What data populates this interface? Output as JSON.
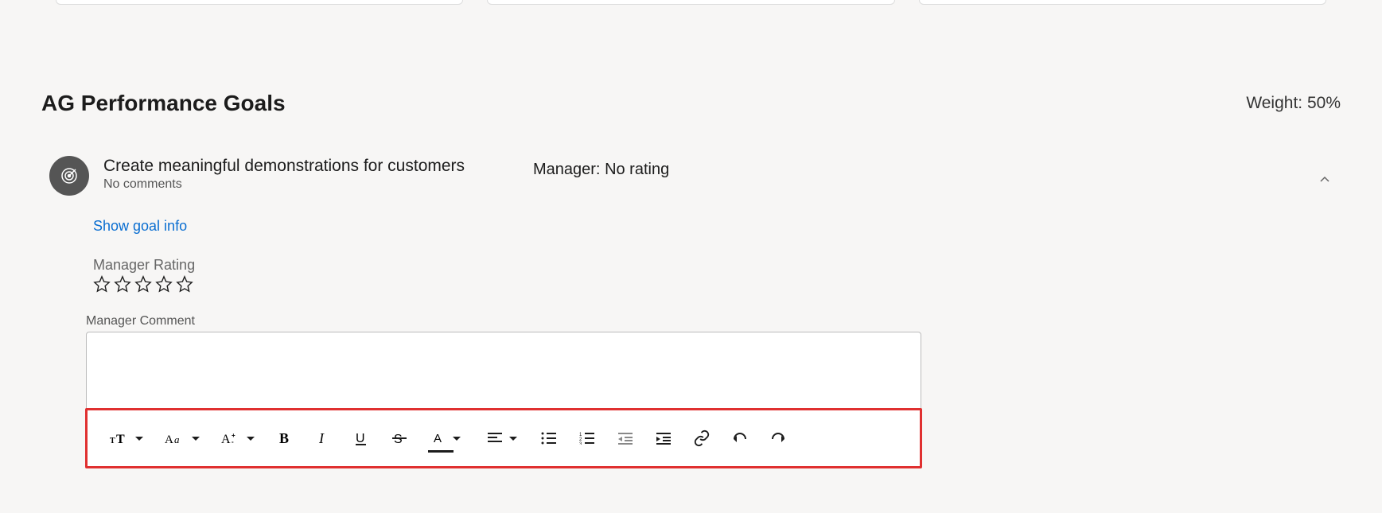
{
  "section": {
    "title": "AG Performance Goals",
    "weight_label": "Weight: 50%"
  },
  "goal": {
    "title": "Create meaningful demonstrations for customers",
    "comments_status": "No comments",
    "manager_status_label": "Manager:",
    "manager_status_value": "No rating",
    "show_info_link": "Show goal info",
    "rating_label": "Manager Rating",
    "rating_value": 0,
    "rating_max": 5,
    "comment_label": "Manager Comment",
    "comment_value": ""
  },
  "toolbar": {
    "items": [
      {
        "name": "heading",
        "has_dropdown": true
      },
      {
        "name": "font-family",
        "has_dropdown": true
      },
      {
        "name": "font-size",
        "has_dropdown": true
      },
      {
        "name": "bold",
        "has_dropdown": false
      },
      {
        "name": "italic",
        "has_dropdown": false
      },
      {
        "name": "underline",
        "has_dropdown": false
      },
      {
        "name": "strikethrough",
        "has_dropdown": false
      },
      {
        "name": "font-color",
        "has_dropdown": true
      },
      {
        "name": "align",
        "has_dropdown": true
      },
      {
        "name": "bullet-list",
        "has_dropdown": false
      },
      {
        "name": "numbered-list",
        "has_dropdown": false
      },
      {
        "name": "outdent",
        "has_dropdown": false
      },
      {
        "name": "indent",
        "has_dropdown": false
      },
      {
        "name": "link",
        "has_dropdown": false
      },
      {
        "name": "undo",
        "has_dropdown": false
      },
      {
        "name": "redo",
        "has_dropdown": false
      }
    ]
  }
}
